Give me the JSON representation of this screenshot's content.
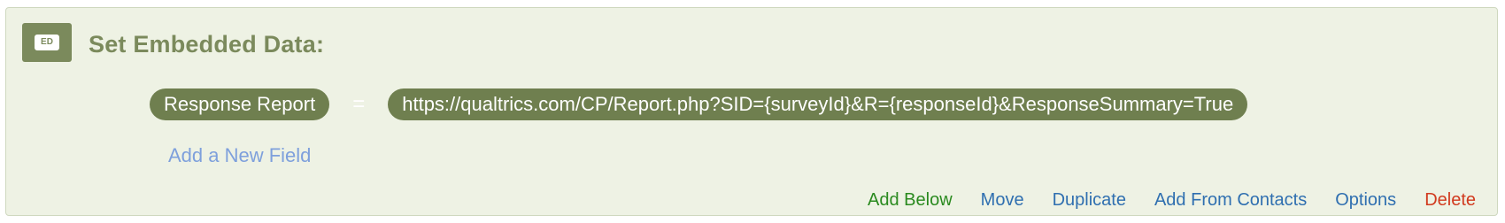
{
  "block": {
    "icon_label": "ED",
    "title": "Set Embedded Data:"
  },
  "field": {
    "name": "Response Report",
    "operator": "=",
    "value": "https://qualtrics.com/CP/Report.php?SID={surveyId}&R={responseId}&ResponseSummary=True"
  },
  "add_field_label": "Add a New Field",
  "actions": {
    "add_below": "Add Below",
    "move": "Move",
    "duplicate": "Duplicate",
    "add_from_contacts": "Add From Contacts",
    "options": "Options",
    "delete": "Delete"
  },
  "colors": {
    "panel_bg": "#eef2e4",
    "accent_olive": "#7b8a5c",
    "pill_bg": "#6f7f4f",
    "link_green": "#2a8a1f",
    "link_blue": "#2f6fb0",
    "link_light_blue": "#7ea0dc",
    "delete_red": "#d13a1e"
  }
}
